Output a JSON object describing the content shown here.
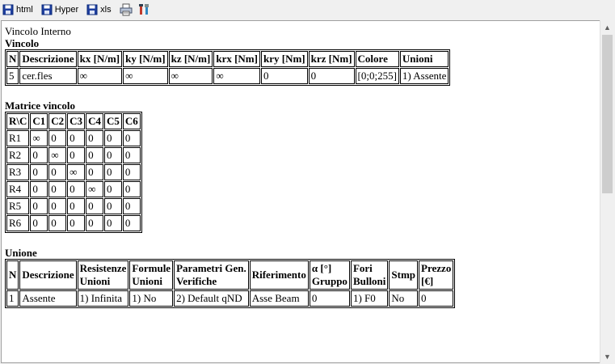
{
  "toolbar": {
    "html_label": "html",
    "hyper_label": "Hyper",
    "xls_label": "xls"
  },
  "page_title": "Vincolo Interno",
  "vincolo": {
    "title": "Vincolo",
    "headers": [
      "N",
      "Descrizione",
      "kx [N/m]",
      "ky [N/m]",
      "kz [N/m]",
      "krx [Nm]",
      "kry [Nm]",
      "krz [Nm]",
      "Colore",
      "Unioni"
    ],
    "rows": [
      [
        "5",
        "cer.fles",
        "∞",
        "∞",
        "∞",
        "∞",
        "0",
        "0",
        "[0;0;255]",
        "1) Assente"
      ]
    ]
  },
  "matrice": {
    "title": "Matrice vincolo",
    "headers": [
      "R\\C",
      "C1",
      "C2",
      "C3",
      "C4",
      "C5",
      "C6"
    ],
    "rows": [
      [
        "R1",
        "∞",
        "0",
        "0",
        "0",
        "0",
        "0"
      ],
      [
        "R2",
        "0",
        "∞",
        "0",
        "0",
        "0",
        "0"
      ],
      [
        "R3",
        "0",
        "0",
        "∞",
        "0",
        "0",
        "0"
      ],
      [
        "R4",
        "0",
        "0",
        "0",
        "∞",
        "0",
        "0"
      ],
      [
        "R5",
        "0",
        "0",
        "0",
        "0",
        "0",
        "0"
      ],
      [
        "R6",
        "0",
        "0",
        "0",
        "0",
        "0",
        "0"
      ]
    ]
  },
  "unione": {
    "title": "Unione",
    "headers": [
      [
        "N"
      ],
      [
        "Descrizione"
      ],
      [
        "Resistenze",
        "Unioni"
      ],
      [
        "Formule",
        "Unioni"
      ],
      [
        "Parametri Gen.",
        "Verifiche"
      ],
      [
        "Riferimento"
      ],
      [
        "α [°]",
        "Gruppo"
      ],
      [
        "Fori",
        "Bulloni"
      ],
      [
        "Stmp"
      ],
      [
        "Prezzo",
        "[€]"
      ]
    ],
    "rows": [
      [
        "1",
        "Assente",
        "1) Infinita",
        "1) No",
        "2) Default qND",
        "Asse Beam",
        "0",
        "1) F0",
        "No",
        "0"
      ]
    ]
  },
  "scrollbar": {
    "up_icon": "scroll-up-icon",
    "down_icon": "scroll-down-icon"
  }
}
